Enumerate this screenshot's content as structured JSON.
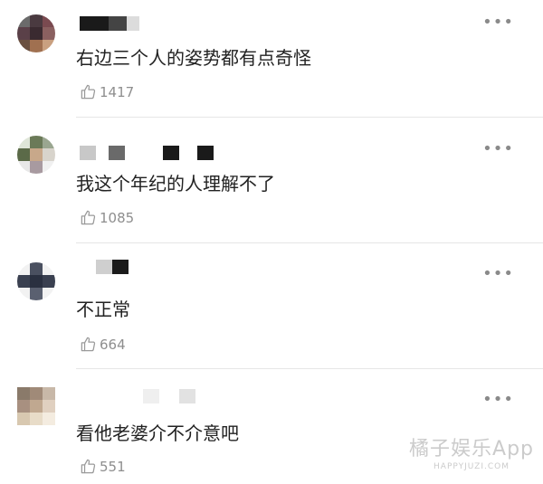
{
  "comments": [
    {
      "text": "右边三个人的姿势都有点奇怪",
      "likes": "1417"
    },
    {
      "text": "我这个年纪的人理解不了",
      "likes": "1085"
    },
    {
      "text": "不正常",
      "likes": "664"
    },
    {
      "text": "看他老婆介不介意吧",
      "likes": "551"
    }
  ],
  "more_glyph": "•••",
  "watermark": {
    "main": "橘子娱乐App",
    "sub": "HAPPYJUZI.COM"
  }
}
